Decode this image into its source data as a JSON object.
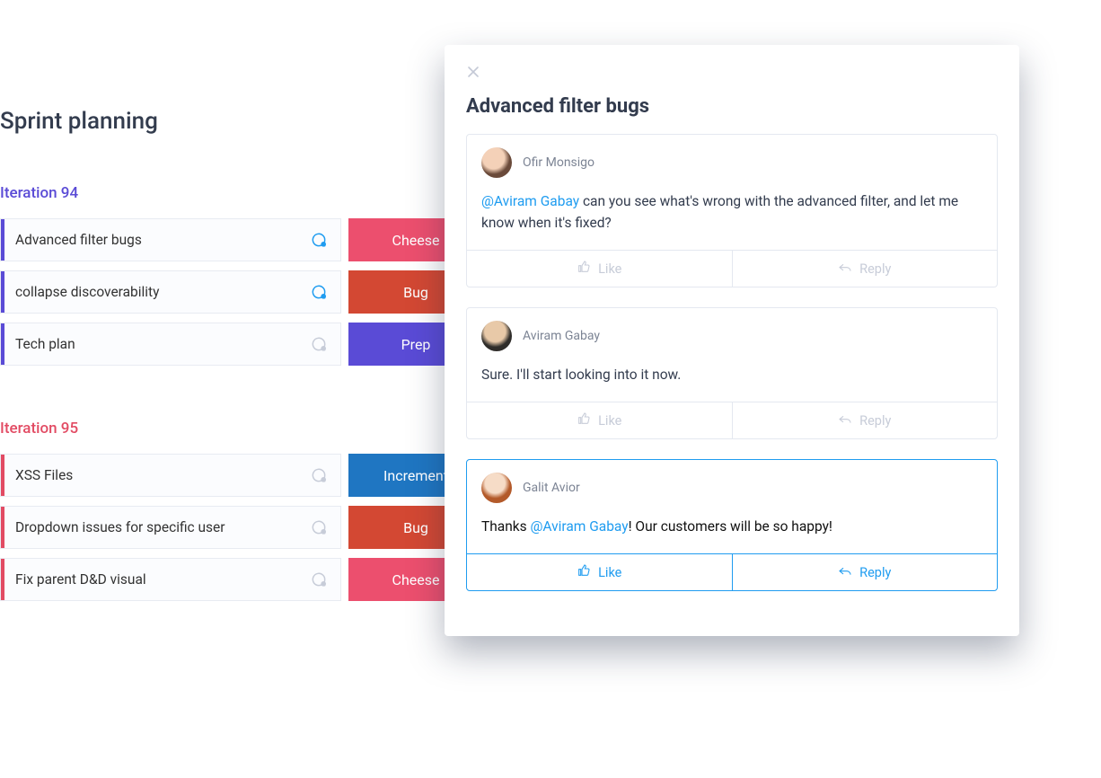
{
  "board": {
    "title": "Sprint planning",
    "iterations": [
      {
        "label": "Iteration 94",
        "color": "purple",
        "rows": [
          {
            "title": "Advanced filter bugs",
            "chat_active": true,
            "tag": "Cheese",
            "tag_color": "pink"
          },
          {
            "title": "collapse discoverability",
            "chat_active": true,
            "tag": "Bug",
            "tag_color": "red"
          },
          {
            "title": "Tech plan",
            "chat_active": false,
            "tag": "Prep",
            "tag_color": "purple"
          }
        ]
      },
      {
        "label": "Iteration 95",
        "color": "red",
        "rows": [
          {
            "title": "XSS Files",
            "chat_active": false,
            "tag": "Increment",
            "tag_color": "blue"
          },
          {
            "title": "Dropdown issues for specific user",
            "chat_active": false,
            "tag": "Bug",
            "tag_color": "red"
          },
          {
            "title": "Fix parent D&D visual",
            "chat_active": false,
            "tag": "Cheese",
            "tag_color": "pink"
          }
        ]
      }
    ]
  },
  "panel": {
    "title": "Advanced filter bugs",
    "like_label": "Like",
    "reply_label": "Reply",
    "comments": [
      {
        "author": "Ofir Monsigo",
        "avatar_class": "a1",
        "highlight": false,
        "segments": [
          {
            "type": "mention",
            "text": "@Aviram Gabay"
          },
          {
            "type": "text",
            "text": " can you see what's wrong with the advanced filter, and let me know when it's fixed?"
          }
        ]
      },
      {
        "author": "Aviram Gabay",
        "avatar_class": "a2",
        "highlight": false,
        "segments": [
          {
            "type": "text",
            "text": "Sure. I'll start looking into it now."
          }
        ]
      },
      {
        "author": "Galit Avior",
        "avatar_class": "a3",
        "highlight": true,
        "segments": [
          {
            "type": "text",
            "text": "Thanks "
          },
          {
            "type": "mention",
            "text": "@Aviram Gabay"
          },
          {
            "type": "text",
            "text": "! Our customers will be so happy!"
          }
        ]
      }
    ]
  }
}
